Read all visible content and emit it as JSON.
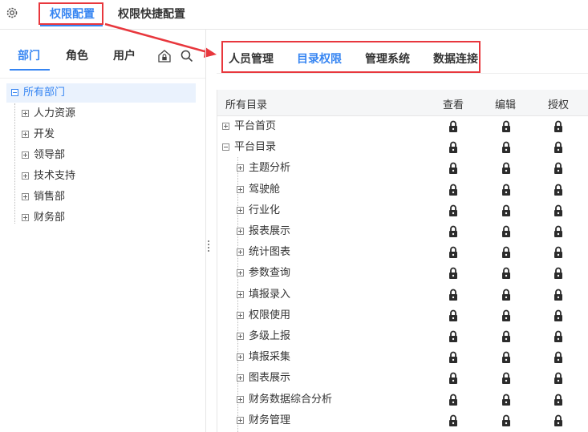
{
  "top_tabs": [
    {
      "label": "权限配置",
      "active": true
    },
    {
      "label": "权限快捷配置",
      "active": false
    }
  ],
  "left_tabs": [
    {
      "label": "部门",
      "active": true
    },
    {
      "label": "角色",
      "active": false
    },
    {
      "label": "用户",
      "active": false
    }
  ],
  "left_tools": [
    "lock-house-icon",
    "search-icon"
  ],
  "tree": {
    "root": "所有部门",
    "children": [
      "人力资源",
      "开发",
      "领导部",
      "技术支持",
      "销售部",
      "财务部"
    ]
  },
  "right_tabs": [
    {
      "label": "人员管理",
      "active": false
    },
    {
      "label": "目录权限",
      "active": true
    },
    {
      "label": "管理系统",
      "active": false
    },
    {
      "label": "数据连接",
      "active": false
    }
  ],
  "table": {
    "headers": [
      "所有目录",
      "查看",
      "编辑",
      "授权"
    ],
    "rows": [
      {
        "label": "平台首页",
        "level": 0,
        "expanded": false
      },
      {
        "label": "平台目录",
        "level": 0,
        "expanded": true
      },
      {
        "label": "主题分析",
        "level": 1,
        "expanded": false
      },
      {
        "label": "驾驶舱",
        "level": 1,
        "expanded": false
      },
      {
        "label": "行业化",
        "level": 1,
        "expanded": false
      },
      {
        "label": "报表展示",
        "level": 1,
        "expanded": false
      },
      {
        "label": "统计图表",
        "level": 1,
        "expanded": false
      },
      {
        "label": "参数查询",
        "level": 1,
        "expanded": false
      },
      {
        "label": "填报录入",
        "level": 1,
        "expanded": false
      },
      {
        "label": "权限使用",
        "level": 1,
        "expanded": false
      },
      {
        "label": "多级上报",
        "level": 1,
        "expanded": false
      },
      {
        "label": "填报采集",
        "level": 1,
        "expanded": false
      },
      {
        "label": "图表展示",
        "level": 1,
        "expanded": false
      },
      {
        "label": "财务数据综合分析",
        "level": 1,
        "expanded": false
      },
      {
        "label": "财务管理",
        "level": 1,
        "expanded": false
      }
    ]
  },
  "colors": {
    "accent": "#3685f2",
    "highlight": "#e8373d",
    "lock": "#2b2b2b"
  }
}
